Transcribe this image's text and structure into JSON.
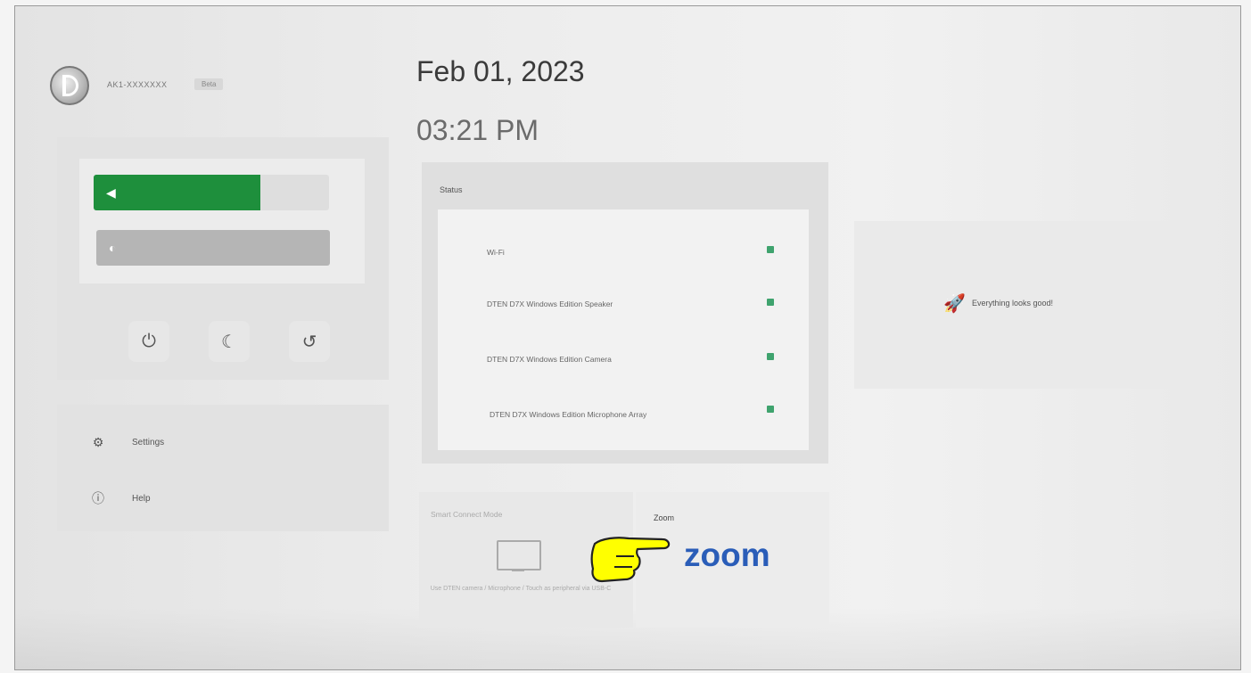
{
  "device": {
    "name": "AK1-XXXXXXX",
    "tag": "Beta"
  },
  "controls": {
    "volume_level": 0.71,
    "brightness_level": 0.0,
    "volume_icon": "speaker-icon",
    "brightness_icon": "brightness-icon",
    "buttons": [
      {
        "name": "power-button",
        "icon": "power-icon",
        "glyph": "⏻"
      },
      {
        "name": "sleep-button",
        "icon": "moon-icon",
        "glyph": "☾"
      },
      {
        "name": "restart-button",
        "icon": "restart-icon",
        "glyph": "↺"
      }
    ]
  },
  "menu": {
    "settings_label": "Settings",
    "settings_icon": "gear-icon",
    "help_label": "Help",
    "help_icon": "info-icon"
  },
  "datetime": {
    "date": "Feb 01, 2023",
    "time": "03:21 PM"
  },
  "status": {
    "title": "Status",
    "items": [
      {
        "label": "Wi-Fi",
        "state": "ok"
      },
      {
        "label": "DTEN D7X Windows Edition Speaker",
        "state": "ok"
      },
      {
        "label": "DTEN D7X Windows Edition Camera",
        "state": "ok"
      },
      {
        "label": "DTEN D7X Windows Edition Microphone Array",
        "state": "ok"
      }
    ],
    "ok_color": "#3fa36e",
    "message": "Everything looks good!"
  },
  "tiles": {
    "smart_connect": {
      "title": "Smart Connect Mode",
      "note": "Use DTEN camera / Microphone / Touch as peripheral via USB-C"
    },
    "zoom": {
      "title": "Zoom",
      "logo_text": "zoom"
    }
  },
  "colors": {
    "accent_green": "#1e8f3c",
    "zoom_blue": "#2a5db8",
    "pointer_yellow": "#ffff00"
  }
}
